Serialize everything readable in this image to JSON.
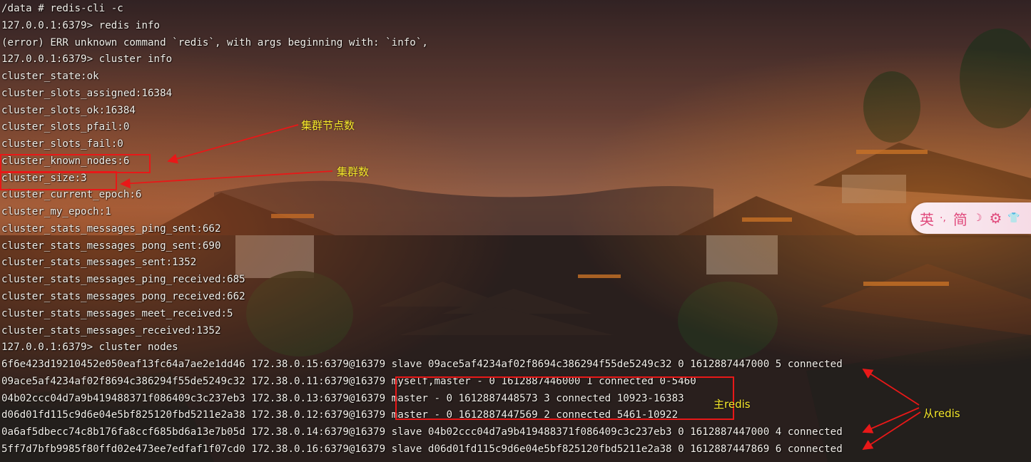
{
  "terminal": {
    "lines": [
      "/data # redis-cli -c",
      "127.0.0.1:6379> redis info",
      "(error) ERR unknown command `redis`, with args beginning with: `info`,",
      "127.0.0.1:6379> cluster info",
      "cluster_state:ok",
      "cluster_slots_assigned:16384",
      "cluster_slots_ok:16384",
      "cluster_slots_pfail:0",
      "cluster_slots_fail:0",
      "cluster_known_nodes:6",
      "cluster_size:3",
      "cluster_current_epoch:6",
      "cluster_my_epoch:1",
      "cluster_stats_messages_ping_sent:662",
      "cluster_stats_messages_pong_sent:690",
      "cluster_stats_messages_sent:1352",
      "cluster_stats_messages_ping_received:685",
      "cluster_stats_messages_pong_received:662",
      "cluster_stats_messages_meet_received:5",
      "cluster_stats_messages_received:1352",
      "127.0.0.1:6379> cluster nodes",
      "6f6e423d19210452e050eaf13fc64a7ae2e1dd46 172.38.0.15:6379@16379 slave 09ace5af4234af02f8694c386294f55de5249c32 0 1612887447000 5 connected",
      "09ace5af4234af02f8694c386294f55de5249c32 172.38.0.11:6379@16379 myself,master - 0 1612887446000 1 connected 0-5460",
      "04b02ccc04d7a9b419488371f086409c3c237eb3 172.38.0.13:6379@16379 master - 0 1612887448573 3 connected 10923-16383",
      "d06d01fd115c9d6e04e5bf825120fbd5211e2a38 172.38.0.12:6379@16379 master - 0 1612887447569 2 connected 5461-10922",
      "0a6af5dbecc74c8b176fa8ccf685bd6a13e7b05d 172.38.0.14:6379@16379 slave 04b02ccc04d7a9b419488371f086409c3c237eb3 0 1612887447000 4 connected",
      "5ff7d7bfb9985f80ffd02e473ee7edfaf1f07cd0 172.38.0.16:6379@16379 slave d06d01fd115c9d6e04e5bf825120fbd5211e2a38 0 1612887447869 6 connected"
    ]
  },
  "annotations": {
    "known_nodes_label": "集群节点数",
    "cluster_size_label": "集群数",
    "master_label": "主redis",
    "slave_label": "从redis"
  },
  "ime": {
    "lang": "英",
    "punct": "·,",
    "mode": "简",
    "moon": "☽",
    "settings": "⚙",
    "skin": "👕"
  },
  "colors": {
    "terminal_text": "#f4f0ea",
    "annotation_text": "#f5e82a",
    "annotation_box": "#e81818",
    "ime_accent": "#e04a7c"
  }
}
